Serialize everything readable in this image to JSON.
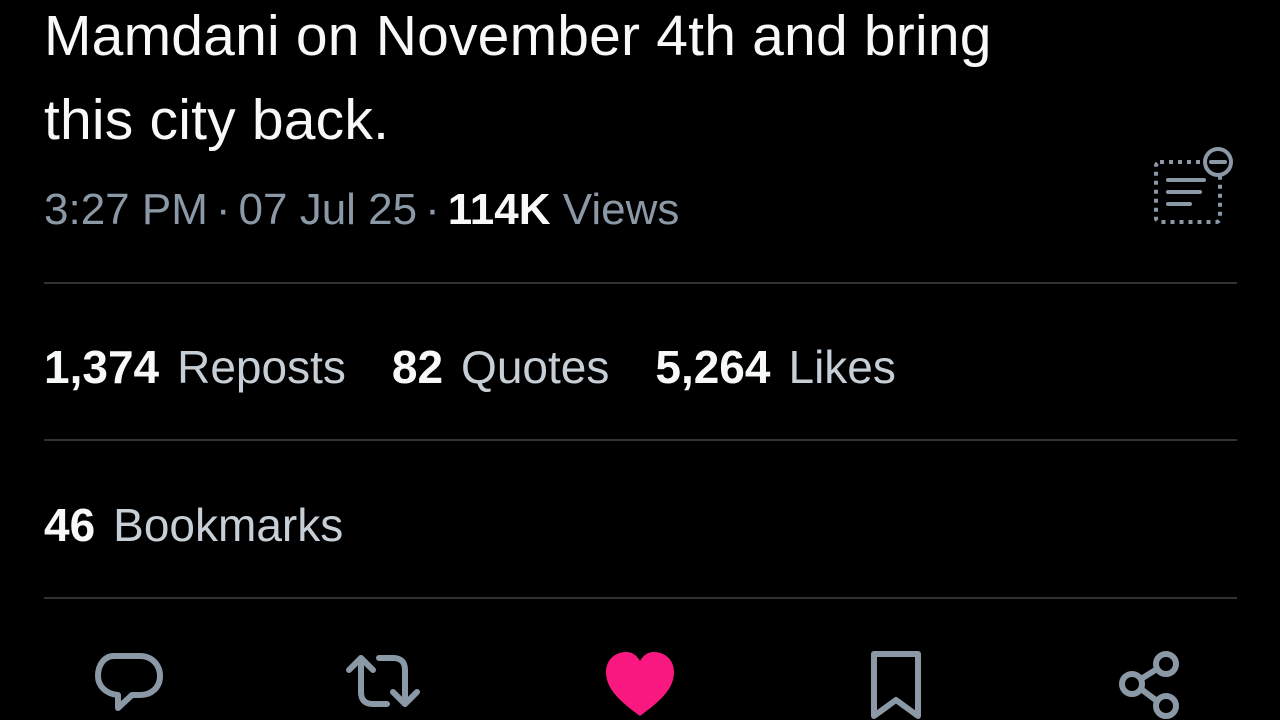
{
  "tweet": {
    "text_lines": [
      "Mamdani on November 4th and bring",
      "this city back."
    ],
    "time": "3:27 PM",
    "date": "07 Jul 25",
    "views_count": "114K",
    "views_label": "Views",
    "separator": "·"
  },
  "stats": {
    "reposts": {
      "count": "1,374",
      "label": "Reposts"
    },
    "quotes": {
      "count": "82",
      "label": "Quotes"
    },
    "likes": {
      "count": "5,264",
      "label": "Likes"
    },
    "bookmarks": {
      "count": "46",
      "label": "Bookmarks"
    }
  },
  "actions": {
    "items": [
      "reply-icon",
      "repost-icon",
      "like-icon",
      "bookmark-icon",
      "share-icon"
    ],
    "liked": true,
    "like_color": "#f91880",
    "icon_color": "#8b98a5"
  },
  "colors": {
    "background": "#000000",
    "text_primary": "#f7f9f9",
    "text_secondary": "#8b98a5",
    "divider": "#2f3336"
  }
}
